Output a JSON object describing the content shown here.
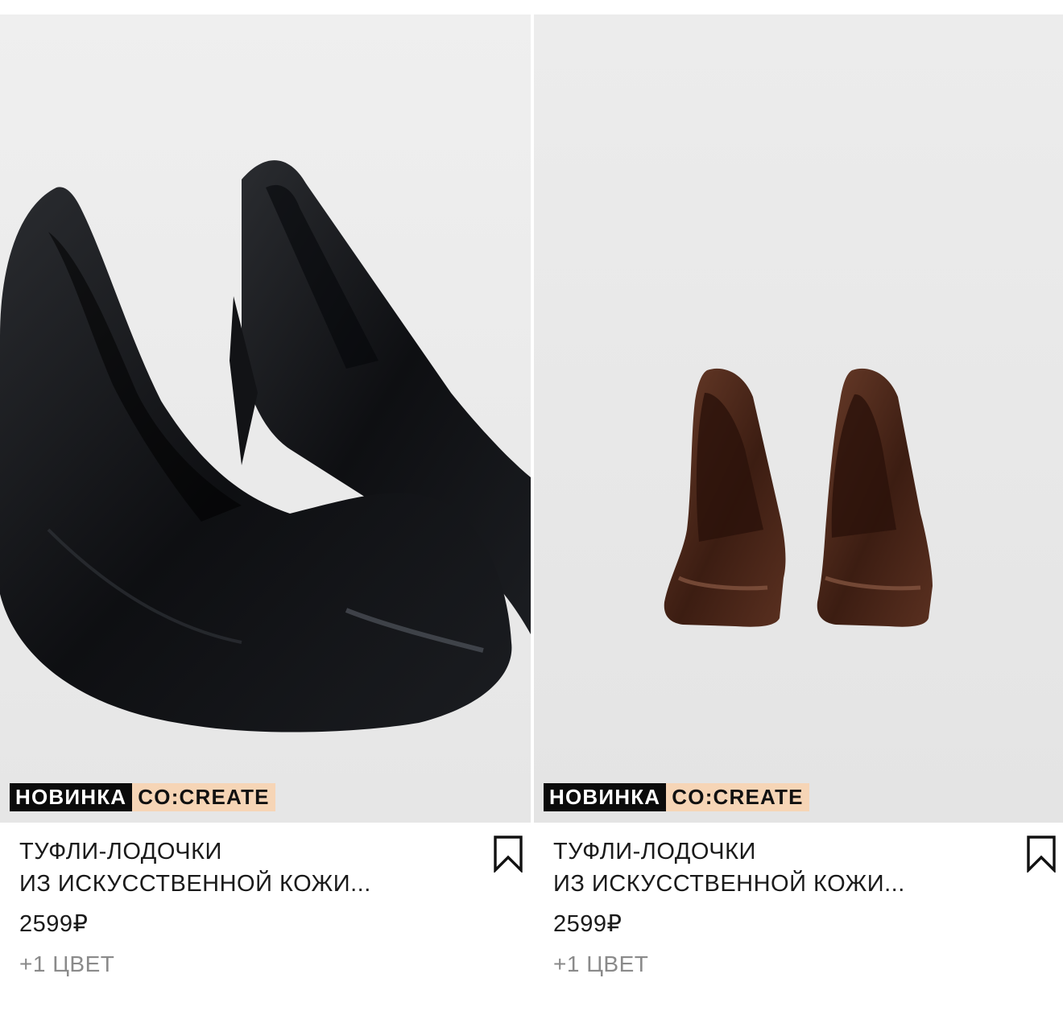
{
  "products": [
    {
      "image_alt": "black faux leather pumps",
      "badge_new": "НОВИНКА",
      "badge_collab": "CO:CREATE",
      "title_line1": "ТУФЛИ-ЛОДОЧКИ",
      "title_line2": "ИЗ ИСКУССТВЕННОЙ КОЖИ...",
      "price": "2599₽",
      "colors": "+1 ЦВЕТ",
      "bookmark_icon": "bookmark-icon"
    },
    {
      "image_alt": "brown faux leather pumps",
      "badge_new": "НОВИНКА",
      "badge_collab": "CO:CREATE",
      "title_line1": "ТУФЛИ-ЛОДОЧКИ",
      "title_line2": "ИЗ ИСКУССТВЕННОЙ КОЖИ...",
      "price": "2599₽",
      "colors": "+1 ЦВЕТ",
      "bookmark_icon": "bookmark-icon"
    }
  ],
  "colors": {
    "photo_bg": "#ededed",
    "badge_new_bg": "#0b0b0b",
    "badge_collab_bg": "#f6d5b6",
    "muted_text": "#8a8a8a"
  }
}
